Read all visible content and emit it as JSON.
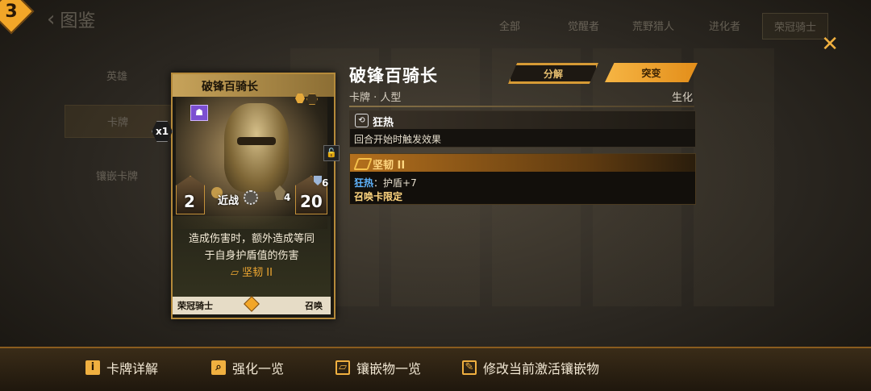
{
  "background": {
    "back_label": "图鉴",
    "filters": [
      "全部",
      "觉醒者",
      "荒野猎人",
      "进化者",
      "荣冠骑士"
    ],
    "side_items": [
      "英雄",
      "卡牌",
      "镶嵌卡牌"
    ]
  },
  "card": {
    "cost": "3",
    "name": "破锋百骑长",
    "copies": "x1",
    "attack": "2",
    "attack_type": "近战",
    "unit_count": "4",
    "health": "20",
    "shield": "6",
    "text_line1": "造成伤害时，额外造成等同",
    "text_line2": "于自身护盾值的伤害",
    "keyword": "坚韧 II",
    "faction": "荣冠骑士",
    "type": "召唤"
  },
  "detail": {
    "title": "破锋百骑长",
    "subtitle": "卡牌 · 人型",
    "race": "生化",
    "decompose_label": "分解",
    "upgrade_label": "突变",
    "ability": {
      "name": "狂热",
      "desc": "回合开始时触发效果"
    },
    "inlay": {
      "name": "坚韧 II",
      "effect_keyword": "狂热",
      "effect_text": "：护盾+7",
      "restriction": "召唤卡限定"
    }
  },
  "bottom_bar": {
    "detail_label": "卡牌详解",
    "enhance_label": "强化一览",
    "inlay_list_label": "镶嵌物一览",
    "modify_inlay_label": "修改当前激活镶嵌物"
  },
  "colors": {
    "accent": "#f0b040",
    "keyword_blue": "#5fb4ff",
    "card_border": "#b58a3a"
  }
}
